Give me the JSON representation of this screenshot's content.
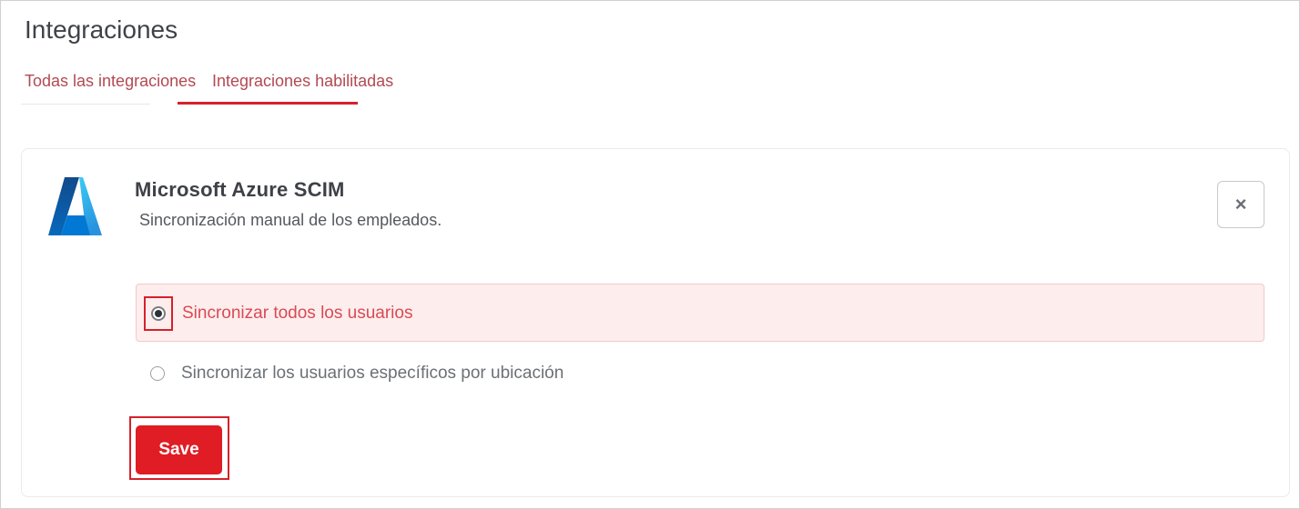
{
  "page": {
    "title": "Integraciones"
  },
  "tabs": [
    {
      "label": "Todas las integraciones",
      "active": false
    },
    {
      "label": "Integraciones habilitadas",
      "active": true
    }
  ],
  "integration": {
    "name": "Microsoft Azure SCIM",
    "description": "Sincronización manual de los empleados.",
    "logo_icon": "azure-logo-icon",
    "close_label": "×"
  },
  "sync_options": [
    {
      "label": "Sincronizar todos los usuarios",
      "selected": true
    },
    {
      "label": "Sincronizar los usuarios específicos por ubicación",
      "selected": false
    }
  ],
  "actions": {
    "save_label": "Save"
  },
  "colors": {
    "accent": "#d6212b",
    "save_button": "#e01d24",
    "selected_option_bg": "#fdeeed",
    "tab_text": "#b24a52"
  }
}
